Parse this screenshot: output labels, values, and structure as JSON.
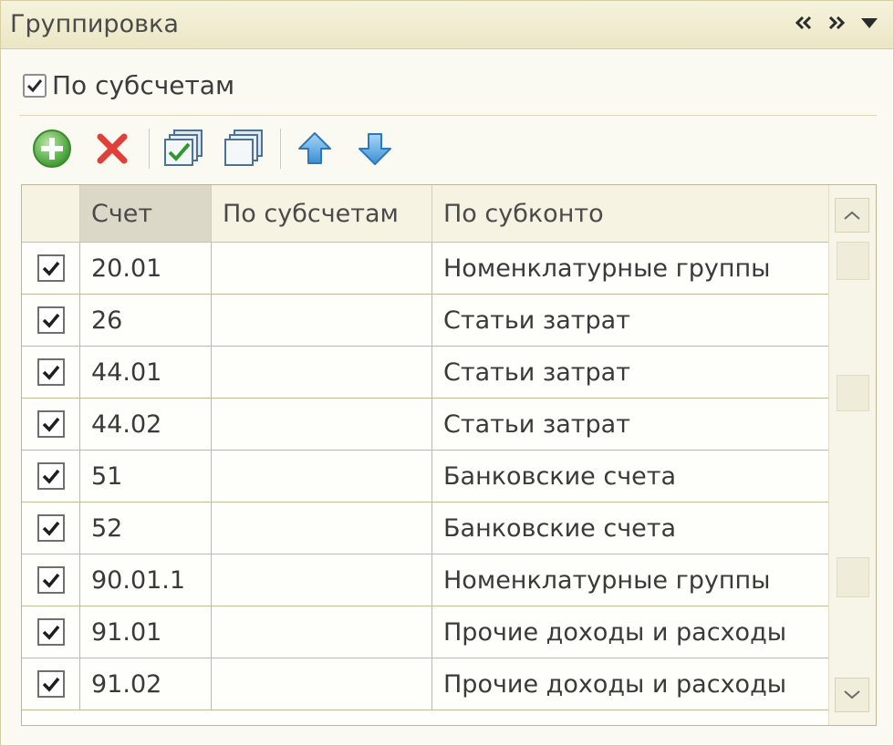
{
  "panel": {
    "title": "Группировка",
    "controls": [
      {
        "name": "collapse-left-icon",
        "glyph": "«"
      },
      {
        "name": "expand-right-icon",
        "glyph": "»"
      },
      {
        "name": "dropdown-icon",
        "glyph": "▼"
      }
    ]
  },
  "options": {
    "by_subaccounts_label": "По субсчетам",
    "by_subaccounts_checked": true
  },
  "toolbar": {
    "buttons": [
      {
        "name": "add-button",
        "icon": "plus-circle-icon",
        "color": "#4fa83d"
      },
      {
        "name": "delete-button",
        "icon": "red-x-icon",
        "color": "#e0403a"
      },
      {
        "name": "check-all-button",
        "icon": "check-all-icon",
        "color": "#3aa63a"
      },
      {
        "name": "uncheck-all-button",
        "icon": "uncheck-all-icon",
        "color": "#6e8ea8"
      },
      {
        "name": "move-up-button",
        "icon": "arrow-up-icon",
        "color": "#4a9ad8"
      },
      {
        "name": "move-down-button",
        "icon": "arrow-down-icon",
        "color": "#4a9ad8"
      }
    ]
  },
  "table": {
    "columns": [
      "",
      "Счет",
      "По субсчетам",
      "По субконто"
    ],
    "rows": [
      {
        "checked": true,
        "account": "20.01",
        "by_subaccounts": "",
        "by_subconto": "Номенклатурные группы"
      },
      {
        "checked": true,
        "account": "26",
        "by_subaccounts": "",
        "by_subconto": "Статьи затрат"
      },
      {
        "checked": true,
        "account": "44.01",
        "by_subaccounts": "",
        "by_subconto": "Статьи затрат"
      },
      {
        "checked": true,
        "account": "44.02",
        "by_subaccounts": "",
        "by_subconto": "Статьи затрат"
      },
      {
        "checked": true,
        "account": "51",
        "by_subaccounts": "",
        "by_subconto": "Банковские счета"
      },
      {
        "checked": true,
        "account": "52",
        "by_subaccounts": "",
        "by_subconto": "Банковские счета"
      },
      {
        "checked": true,
        "account": "90.01.1",
        "by_subaccounts": "",
        "by_subconto": "Номенклатурные группы"
      },
      {
        "checked": true,
        "account": "91.01",
        "by_subaccounts": "",
        "by_subconto": "Прочие доходы и расходы"
      },
      {
        "checked": true,
        "account": "91.02",
        "by_subaccounts": "",
        "by_subconto": "Прочие доходы и расходы"
      }
    ]
  },
  "colors": {
    "titlebar": "#ebe6c4",
    "border": "#c2bb98",
    "selected_header": "#dcd8c8"
  }
}
